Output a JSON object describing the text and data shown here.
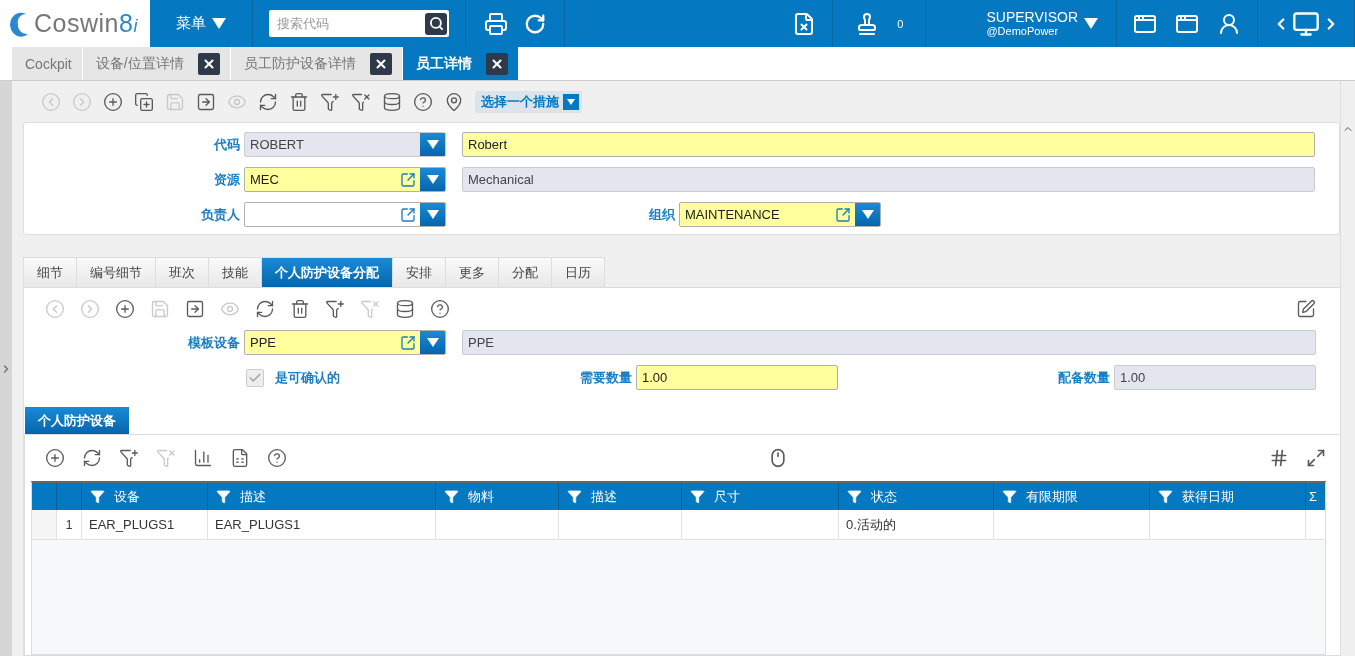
{
  "header": {
    "logo": {
      "name": "Coswin",
      "version": "8",
      "edition": "i"
    },
    "menu": "菜单",
    "search": {
      "placeholder": "搜索代码"
    },
    "stamp_count": "0",
    "user": {
      "name": "SUPERVISOR",
      "domain": "@DemoPower"
    }
  },
  "doc_tabs": [
    {
      "label": "Cockpit",
      "closable": false,
      "selected": false
    },
    {
      "label": "设备/位置详情",
      "closable": true,
      "selected": false
    },
    {
      "label": "员工防护设备详情",
      "closable": true,
      "selected": false
    },
    {
      "label": "员工详情",
      "closable": true,
      "selected": true
    }
  ],
  "toolbar": {
    "buttons": [
      {
        "kind": "prev",
        "disabled": true
      },
      {
        "kind": "next",
        "disabled": true
      },
      {
        "kind": "add",
        "disabled": false
      },
      {
        "kind": "add_copy",
        "disabled": false
      },
      {
        "kind": "save",
        "disabled": true
      },
      {
        "kind": "export",
        "disabled": false
      },
      {
        "kind": "view",
        "disabled": true
      },
      {
        "kind": "refresh",
        "disabled": false
      },
      {
        "kind": "delete",
        "disabled": false
      },
      {
        "kind": "filter_add",
        "disabled": false
      },
      {
        "kind": "filter_remove",
        "disabled": false
      },
      {
        "kind": "query",
        "disabled": false
      },
      {
        "kind": "help",
        "disabled": false
      },
      {
        "kind": "locate",
        "disabled": false
      }
    ],
    "action_select": "选择一个措施"
  },
  "record": {
    "rows": [
      {
        "label": "代码",
        "lookup": {
          "value": "ROBERT",
          "required": false,
          "readonly": true,
          "link": false
        },
        "description": {
          "value": "Robert",
          "required": true,
          "readonly": false
        }
      },
      {
        "label": "资源",
        "lookup": {
          "value": "MEC",
          "required": true,
          "readonly": false,
          "link": true
        },
        "description": {
          "value": "Mechanical",
          "required": false,
          "readonly": true
        }
      },
      {
        "label": "负责人",
        "lookup": {
          "required": false,
          "readonly": false,
          "link": true
        },
        "side": {
          "label": "组织",
          "lookup": {
            "value": "MAINTENANCE",
            "required": true,
            "readonly": false,
            "link": true
          }
        }
      }
    ]
  },
  "detail_tabs": [
    {
      "label": "细节",
      "selected": false
    },
    {
      "label": "编号细节",
      "selected": false
    },
    {
      "label": "班次",
      "selected": false
    },
    {
      "label": "技能",
      "selected": false
    },
    {
      "label": "个人防护设备分配",
      "selected": true
    },
    {
      "label": "安排",
      "selected": false
    },
    {
      "label": "更多",
      "selected": false
    },
    {
      "label": "分配",
      "selected": false
    },
    {
      "label": "日历",
      "selected": false
    }
  ],
  "ppe_panel": {
    "toolbar": [
      {
        "kind": "prev",
        "disabled": true
      },
      {
        "kind": "next",
        "disabled": true
      },
      {
        "kind": "add",
        "disabled": false
      },
      {
        "kind": "save",
        "disabled": true
      },
      {
        "kind": "export",
        "disabled": false
      },
      {
        "kind": "view",
        "disabled": true
      },
      {
        "kind": "refresh",
        "disabled": false
      },
      {
        "kind": "delete",
        "disabled": false
      },
      {
        "kind": "filter_add",
        "disabled": false
      },
      {
        "kind": "filter_remove",
        "disabled": true
      },
      {
        "kind": "query",
        "disabled": false
      },
      {
        "kind": "help",
        "disabled": false
      }
    ],
    "template": {
      "label": "模板设备",
      "lookup": {
        "value": "PPE",
        "required": true,
        "readonly": false,
        "link": true
      },
      "description": {
        "value": "PPE",
        "required": false,
        "readonly": true
      }
    },
    "confirmable": {
      "label": "是可确认的",
      "checked": true,
      "disabled": true
    },
    "required_qty": {
      "label": "需要数量",
      "value": "1.00",
      "required": true,
      "readonly": false
    },
    "issued_qty": {
      "label": "配备数量",
      "value": "1.00",
      "required": false,
      "readonly": true
    }
  },
  "grid": {
    "tab": "个人防护设备",
    "toolbar": [
      {
        "kind": "add",
        "disabled": false
      },
      {
        "kind": "refresh",
        "disabled": false
      },
      {
        "kind": "filter_add",
        "disabled": false
      },
      {
        "kind": "filter_remove",
        "disabled": true
      },
      {
        "kind": "chart_add",
        "disabled": false
      },
      {
        "kind": "excel",
        "disabled": false
      },
      {
        "kind": "help",
        "disabled": false
      }
    ],
    "columns": [
      {
        "label": "设备",
        "filter": true
      },
      {
        "label": "描述",
        "filter": true
      },
      {
        "label": "物料",
        "filter": true
      },
      {
        "label": "描述",
        "filter": true
      },
      {
        "label": "尺寸",
        "filter": true
      },
      {
        "label": "状态",
        "filter": true
      },
      {
        "label": "有限期限",
        "filter": true
      },
      {
        "label": "获得日期",
        "filter": true
      },
      {
        "label": "Σ",
        "filter": false
      }
    ],
    "rows": [
      {
        "number": "1",
        "cells": [
          "EAR_PLUGS1",
          "EAR_PLUGS1",
          null,
          null,
          null,
          "0.活动的",
          null,
          null,
          null
        ]
      }
    ]
  }
}
